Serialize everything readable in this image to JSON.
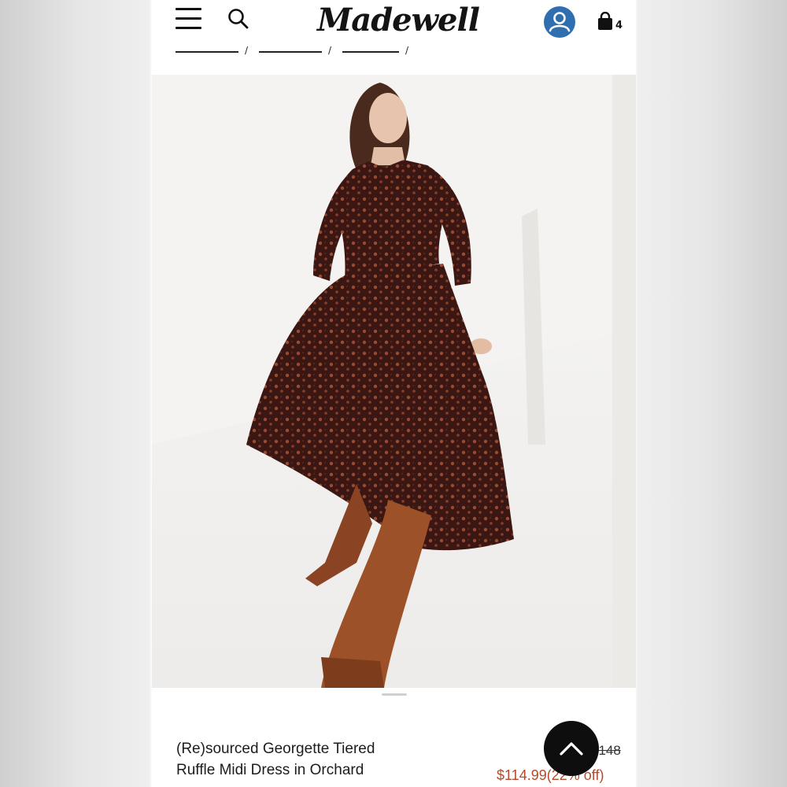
{
  "header": {
    "logo_text": "Madewell",
    "bag_count": "4",
    "menu_icon": "hamburger-menu-icon",
    "search_icon": "search-icon",
    "account_icon": "account-icon",
    "bag_icon": "shopping-bag-icon"
  },
  "breadcrumb": {
    "separators": [
      "/",
      "/",
      "/"
    ]
  },
  "hero": {
    "image": "product-photo"
  },
  "product": {
    "title_lines": [
      "(Re)sourced Georgette Tiered",
      "Ruffle Midi Dress in Orchard"
    ],
    "sale_price": "$114.99",
    "discount": "(22% off)",
    "original_price": "$148"
  },
  "scroll_top": {
    "icon": "chevron-up-icon"
  },
  "colors": {
    "accent_blue": "#2f6fb0",
    "sale_red": "#b54a2b",
    "dark": "#0e0e0e"
  }
}
